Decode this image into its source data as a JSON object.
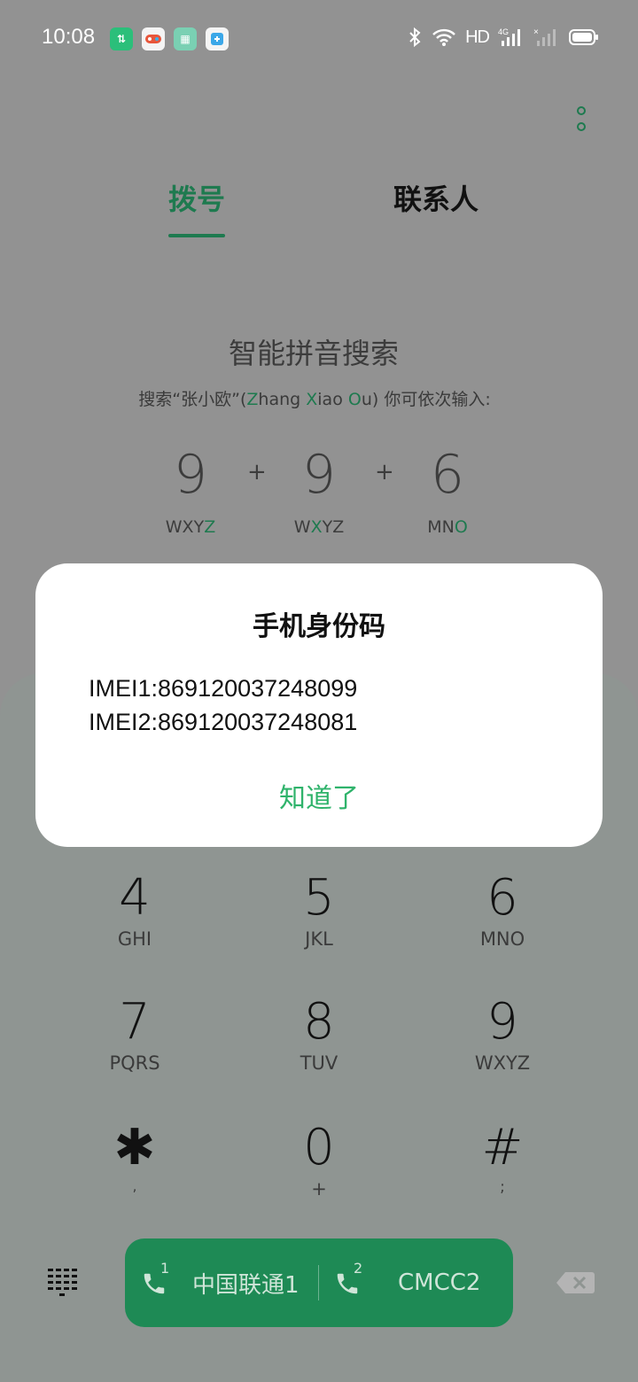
{
  "status_bar": {
    "time": "10:08",
    "notification_icons": [
      "data-transfer-icon",
      "game-center-icon",
      "app-store-icon",
      "screenshot-icon"
    ],
    "network_label": "HD",
    "signal_label": "4G"
  },
  "tabs": {
    "dial": "拨号",
    "contacts": "联系人",
    "active": "dial"
  },
  "search_hint": {
    "title": "智能拼音搜索",
    "desc_prefix": "搜索“张小欧”(",
    "z": "Z",
    "hang": "hang ",
    "x": "X",
    "iao": "iao ",
    "o": "O",
    "u": "u",
    "desc_suffix": ") 你可依次输入:",
    "keys": [
      {
        "digit": "9",
        "letters_plain": "WXY",
        "letters_hl": "Z"
      },
      {
        "digit": "9",
        "letters_pre": "W",
        "letters_hl": "X",
        "letters_post": "YZ"
      },
      {
        "digit": "6",
        "letters_plain": "MN",
        "letters_hl": "O"
      }
    ],
    "plus": "+"
  },
  "dialog": {
    "title": "手机身份码",
    "imei1": "IMEI1:869120037248099",
    "imei2": "IMEI2:869120037248081",
    "confirm": "知道了"
  },
  "keypad": [
    {
      "num": "4",
      "sub": "GHI"
    },
    {
      "num": "5",
      "sub": "JKL"
    },
    {
      "num": "6",
      "sub": "MNO"
    },
    {
      "num": "7",
      "sub": "PQRS"
    },
    {
      "num": "8",
      "sub": "TUV"
    },
    {
      "num": "9",
      "sub": "WXYZ"
    },
    {
      "num": "✱",
      "sub": ","
    },
    {
      "num": "0",
      "sub": "+"
    },
    {
      "num": "#",
      "sub": ";"
    }
  ],
  "call_bar": {
    "sim1_number": "1",
    "sim1_label": "中国联通1",
    "sim2_number": "2",
    "sim2_label": "CMCC2"
  },
  "colors": {
    "accent": "#1e7a4f",
    "confirm": "#2fb36b",
    "call_bar": "#1e8a55"
  }
}
